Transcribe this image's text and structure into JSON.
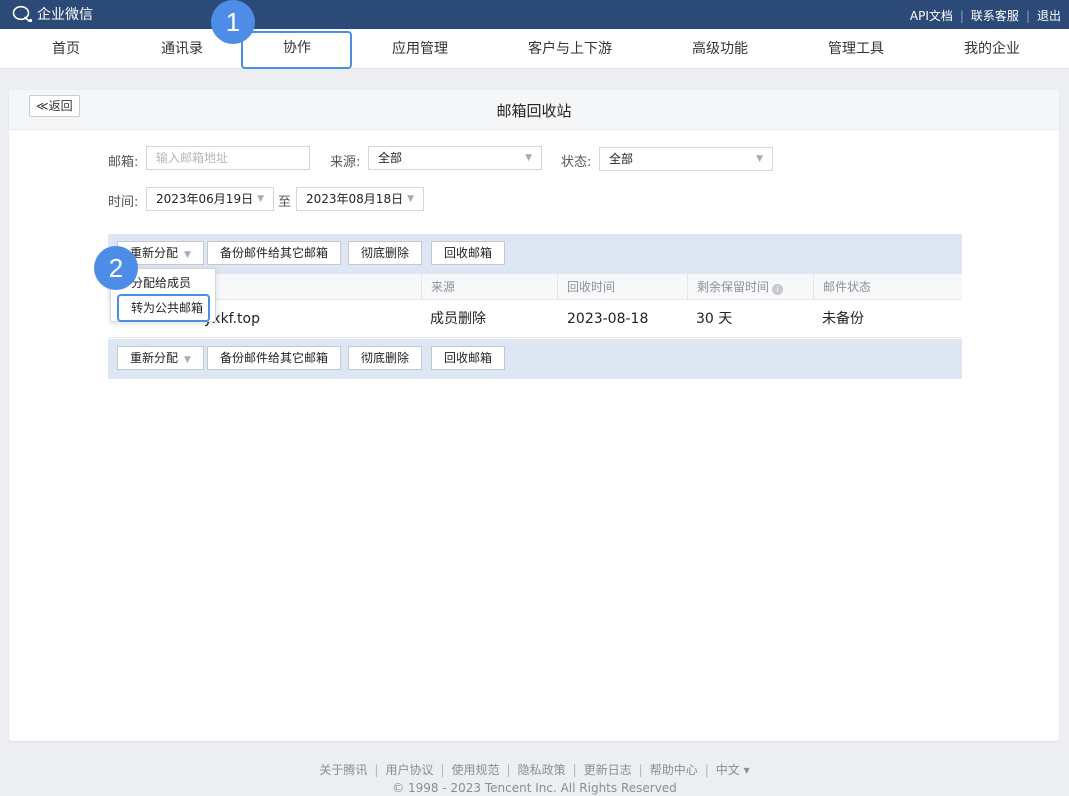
{
  "topbar": {
    "app_name": "企业微信",
    "links": [
      "API文档",
      "联系客服",
      "退出"
    ]
  },
  "nav": {
    "items": [
      "首页",
      "通讯录",
      "协作",
      "应用管理",
      "客户与上下游",
      "高级功能",
      "管理工具",
      "我的企业"
    ],
    "active": "协作"
  },
  "steps": [
    "1",
    "2"
  ],
  "panel": {
    "back_label": "≪返回",
    "title": "邮箱回收站"
  },
  "filters": {
    "email_label": "邮箱:",
    "email_placeholder": "输入邮箱地址",
    "source_label": "来源:",
    "source_value": "全部",
    "status_label": "状态:",
    "status_value": "全部",
    "time_label": "时间:",
    "date_from": "2023年06月19日",
    "date_to_label": "至",
    "date_to": "2023年08月18日"
  },
  "toolbar": {
    "reassign": "重新分配",
    "backup": "备份邮件给其它邮箱",
    "delete": "彻底删除",
    "recover": "回收邮箱"
  },
  "dropdown": {
    "items": [
      "分配给成员",
      "转为公共邮箱"
    ]
  },
  "table": {
    "columns": [
      "来源",
      "回收时间",
      "剩余保留时间",
      "邮件状态"
    ],
    "rows": [
      {
        "email": "yxkf.top",
        "source": "成员删除",
        "time": "2023-08-18",
        "remaining": "30 天",
        "status": "未备份"
      }
    ]
  },
  "footer": {
    "links": [
      "关于腾讯",
      "用户协议",
      "使用规范",
      "隐私政策",
      "更新日志",
      "帮助中心",
      "中文 ▾"
    ],
    "copyright": "© 1998 - 2023 Tencent Inc. All Rights Reserved"
  },
  "colors": {
    "topbar": "#2c4a77",
    "accent": "#4a8fe6",
    "toolbar_bg": "#dde6f2"
  }
}
